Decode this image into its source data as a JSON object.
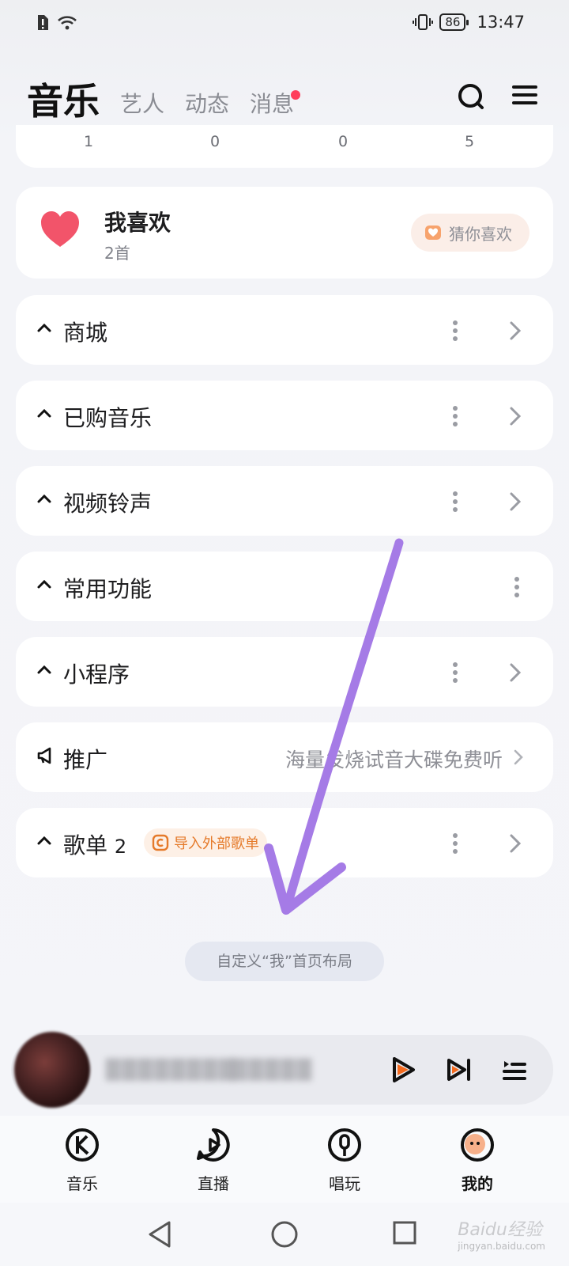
{
  "status_bar": {
    "time": "13:47",
    "battery": "86"
  },
  "top_tabs": [
    {
      "label": "音乐",
      "active": true
    },
    {
      "label": "艺人",
      "active": false
    },
    {
      "label": "动态",
      "active": false
    },
    {
      "label": "消息",
      "active": false,
      "badge": true
    }
  ],
  "stats": [
    "1",
    "0",
    "0",
    "5"
  ],
  "favorites": {
    "title": "我喜欢",
    "count": "2首",
    "guess_label": "猜你喜欢"
  },
  "sections": [
    {
      "title": "商城"
    },
    {
      "title": "已购音乐"
    },
    {
      "title": "视频铃声"
    },
    {
      "title": "常用功能"
    },
    {
      "title": "小程序"
    }
  ],
  "promo": {
    "title": "推广",
    "text": "海量发烧试音大碟免费听"
  },
  "playlist": {
    "title": "歌单",
    "count": "2",
    "import_label": "导入外部歌单"
  },
  "customize_label": "自定义“我”首页布局",
  "player": {
    "title": "████████",
    "artist": "█████"
  },
  "bottom_nav": [
    {
      "label": "音乐",
      "icon": "k-logo-icon"
    },
    {
      "label": "直播",
      "icon": "live-play-icon"
    },
    {
      "label": "唱玩",
      "icon": "microphone-icon"
    },
    {
      "label": "我的",
      "icon": "avatar-icon",
      "active": true
    }
  ],
  "colors": {
    "accent": "#f46a1e",
    "heart": "#f2546a",
    "arrow_overlay": "#a57be6",
    "badge": "#ff3e5b"
  },
  "watermark": {
    "brand": "Baidu经验",
    "url": "jingyan.baidu.com"
  }
}
